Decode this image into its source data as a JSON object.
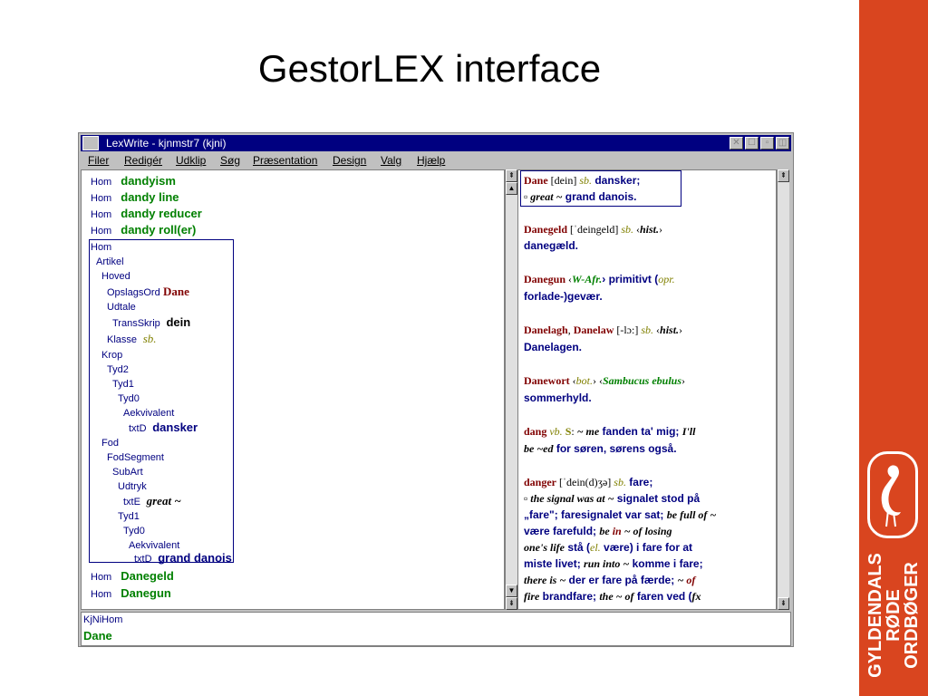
{
  "slide": {
    "title": "GestorLEX interface"
  },
  "brand": {
    "line1": "GYLDENDALS",
    "line2": "RØDE",
    "line3": "ORDBØGER"
  },
  "window": {
    "title": "LexWrite - kjnmstr7 (kjni)",
    "menu": [
      "Filer",
      "Redigér",
      "Udklip",
      "Søg",
      "Præsentation",
      "Design",
      "Valg",
      "Hjælp"
    ]
  },
  "entries_top": [
    {
      "tag": "Hom",
      "word": "dandyism"
    },
    {
      "tag": "Hom",
      "word": "dandy line"
    },
    {
      "tag": "Hom",
      "word": "dandy reducer"
    },
    {
      "tag": "Hom",
      "word": "dandy roll(er)"
    }
  ],
  "tree": [
    {
      "tag": "Hom",
      "value": "",
      "style": ""
    },
    {
      "tag": "Artikel",
      "value": "",
      "style": ""
    },
    {
      "tag": "Hoved",
      "value": "",
      "style": ""
    },
    {
      "tag": "OpslagsOrd",
      "value": "Dane",
      "style": "hw-red"
    },
    {
      "tag": "Udtale",
      "value": "",
      "style": ""
    },
    {
      "tag": "TransSkrip",
      "value": "dein",
      "style": "val-blk"
    },
    {
      "tag": "Klasse",
      "value": "sb.",
      "style": "val-olive"
    },
    {
      "tag": "Krop",
      "value": "",
      "style": ""
    },
    {
      "tag": "Tyd2",
      "value": "",
      "style": ""
    },
    {
      "tag": "Tyd1",
      "value": "",
      "style": ""
    },
    {
      "tag": "Tyd0",
      "value": "",
      "style": ""
    },
    {
      "tag": "Aekvivalent",
      "value": "",
      "style": ""
    },
    {
      "tag": "txtD",
      "value": "dansker",
      "style": "val-blue"
    },
    {
      "tag": "Fod",
      "value": "",
      "style": ""
    },
    {
      "tag": "FodSegment",
      "value": "",
      "style": ""
    },
    {
      "tag": "SubArt",
      "value": "",
      "style": ""
    },
    {
      "tag": "Udtryk",
      "value": "",
      "style": ""
    },
    {
      "tag": "txtE",
      "value": "great ~",
      "style": "val-ital"
    },
    {
      "tag": "Tyd1",
      "value": "",
      "style": ""
    },
    {
      "tag": "Tyd0",
      "value": "",
      "style": ""
    },
    {
      "tag": "Aekvivalent",
      "value": "",
      "style": ""
    },
    {
      "tag": "txtD",
      "value": "grand danois",
      "style": "val-blue"
    }
  ],
  "entries_bottom": [
    {
      "tag": "Hom",
      "word": "Danegeld"
    },
    {
      "tag": "Hom",
      "word": "Danegun"
    }
  ],
  "dict": {
    "l01a": "Dane",
    "l01b": " [dein] ",
    "l01c": "sb.",
    "l01d": " dansker;",
    "l02a": "▫ ",
    "l02b": "great ~",
    "l02c": " grand danois.",
    "l03a": "Danegeld",
    "l03b": " [ˈdeingeld] ",
    "l03c": "sb.",
    "l03d": " ‹",
    "l03e": "hist.",
    "l03f": "›",
    "l04": "danegæld.",
    "l05a": "Danegun",
    "l05b": " ‹",
    "l05c": "W-Afr.",
    "l05d": "› primitivt (",
    "l05e": "opr.",
    "l06": "forlade-)gevær.",
    "l07a": "Danelagh",
    "l07b": ", ",
    "l07c": "Danelaw",
    "l07d": " [-lɔ:] ",
    "l07e": "sb.",
    "l07f": " ‹",
    "l07g": "hist.",
    "l07h": "›",
    "l08": "Danelagen.",
    "l09a": "Danewort",
    "l09b": " ‹",
    "l09c": "bot.",
    "l09d": "› ‹",
    "l09e": "Sambucus ebulus",
    "l09f": "›",
    "l10": "sommerhyld.",
    "l11a": "dang",
    "l11b": " vb.",
    "l11c": " S",
    "l11d": ": ",
    "l11e": "~ me",
    "l11f": " fanden ta' mig; ",
    "l11g": "I'll",
    "l12a": "be ~ed",
    "l12b": " for søren, sørens også.",
    "l13a": "danger",
    "l13b": " [ˈdein(d)ʒə] ",
    "l13c": "sb.",
    "l13d": " fare;",
    "l14a": "▫ ",
    "l14b": "the signal was at ~",
    "l14c": " signalet stod på",
    "l15a": "„fare\"; faresignalet var sat; ",
    "l15b": "be full of ~",
    "l16a": "være farefuld; ",
    "l16b": "be ",
    "l16c": "in",
    "l16d": " ~ of losing",
    "l17a": "one's life",
    "l17b": " stå (",
    "l17c": "el.",
    "l17d": " være) i fare for at",
    "l18a": "miste livet; ",
    "l18b": "run into ~",
    "l18c": " komme i fare;",
    "l19a": "there is ~",
    "l19b": " der er fare på færde; ",
    "l19c": "~ ",
    "l19d": "of",
    "l20a": "fire",
    "l20b": " brandfare; ",
    "l20c": "the ~ of",
    "l20d": " faren ved (",
    "l20e": "fx"
  },
  "status": {
    "path": "KjNiHom",
    "value": "Dane"
  }
}
